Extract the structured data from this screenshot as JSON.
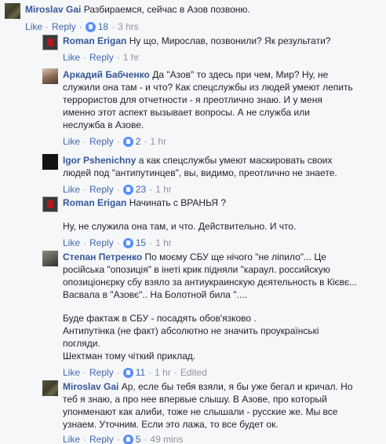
{
  "comments": [
    {
      "name": "Miroslav Gai",
      "lines": [
        "Разбираемся, сейчас в Азов позвоню."
      ],
      "like": "Like",
      "reply": "Reply",
      "likes": "18",
      "time": "3 hrs",
      "avatar": "military-avatar"
    },
    {
      "name": "Roman Erigan",
      "lines": [
        "Ну що, Мирослав, позвонили? Як результати?"
      ],
      "like": "Like",
      "reply": "Reply",
      "time": "1 hr",
      "avatar": "red-shield-avatar"
    },
    {
      "name": "Аркадий Бабченко",
      "lines": [
        "Да \"Азов\" то здесь при чем, Мир? Ну, не",
        "служили она там - и что? Как спецслужбы из людей умеют лепить",
        "террористов для отчетности - я преотлично знаю. И у меня",
        "именно этот аспект вызывает вопросы. А не служба или",
        "неслужба в Азове."
      ],
      "like": "Like",
      "reply": "Reply",
      "likes": "2",
      "time": "1 hr",
      "avatar": "portrait-avatar"
    },
    {
      "name": "Igor Pshenichny",
      "lines": [
        "а как спецслужбы умеют маскировать своих",
        "людей под \"антипутинцев\", вы, видимо, преотлично не знаете."
      ],
      "like": "Like",
      "reply": "Reply",
      "likes": "23",
      "time": "1 hr",
      "avatar": "dark-avatar"
    },
    {
      "name": "Roman Erigan",
      "lines": [
        "Начинать с ВРАНЬЯ ?"
      ],
      "lines2": [
        "Ну, не служила она там, и что. Действительно. И что."
      ],
      "like": "Like",
      "reply": "Reply",
      "likes": "15",
      "time": "1 hr",
      "avatar": "red-shield-avatar"
    },
    {
      "name": "Степан Петренко",
      "lines": [
        "По моєму СБУ ще нічого \"не ліпило\"... Це",
        "російська \"опозиція\" в інеті крик підняли \"караул. российскую",
        "опозиціонєрку сбу взяло за антиукраинскую дєятельность в Кієвє...",
        "Васвала в \"Азовє\".. На Болотной била \"...."
      ],
      "lines2": [
        "Буде фактаж в СБУ - посадять обов'язково .",
        "Антипутінка (не факт) абсолютно не значить проукраїнські",
        "погляди.",
        "Шехтман тому чіткий приклад."
      ],
      "like": "Like",
      "reply": "Reply",
      "likes": "11",
      "time": "1 hr",
      "edited": "Edited",
      "avatar": "soldier-avatar"
    },
    {
      "name": "Miroslav Gai",
      "lines": [
        "Ар, еслe бы тебя взяли, я бы уже бегал и кричал. Но",
        "теб я знаю, а про нее впервые слышу. В Азове, про который",
        "упонменают как алиби, тоже не слышали - русские же. Мы все",
        "узнаем. Уточним. Если это лажа, то все будет ок."
      ],
      "like": "Like",
      "reply": "Reply",
      "likes": "5",
      "time": "49 mins",
      "avatar": "military-avatar"
    }
  ]
}
